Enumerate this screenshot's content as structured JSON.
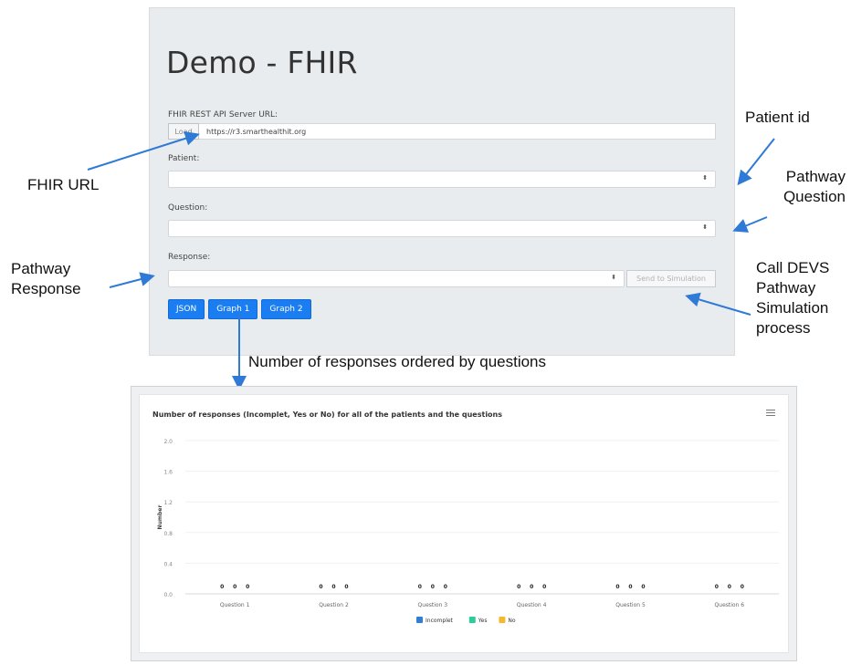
{
  "app": {
    "title": "Demo - FHIR",
    "url_label": "FHIR REST API Server URL:",
    "load_label": "Load",
    "url_value": "https://r3.smarthealthit.org",
    "patient_label": "Patient:",
    "question_label": "Question:",
    "response_label": "Response:",
    "caret": "⬍",
    "send_label": "Send to Simulation",
    "buttons": [
      "JSON",
      "Graph 1",
      "Graph 2"
    ]
  },
  "annotations": {
    "fhir_url": "FHIR URL",
    "patient_id": "Patient id",
    "pathway_question_1": "Pathway",
    "pathway_question_2": "Question",
    "pathway_response_1": "Pathway",
    "pathway_response_2": "Response",
    "devs_1": "Call DEVS",
    "devs_2": "Pathway",
    "devs_3": "Simulation",
    "devs_4": "process",
    "graph_caption": "Number of responses ordered by questions"
  },
  "colors": {
    "incomplet": "#2f7ed8",
    "yes": "#2ecc9a",
    "no": "#f5b82e",
    "button_blue": "#1a7ef2"
  },
  "chart_data": {
    "type": "bar",
    "title": "Number of responses (Incomplet, Yes or No) for all of the patients and the questions",
    "ylabel": "Number",
    "xlabel": "",
    "ylim": [
      0,
      2.0
    ],
    "yticks": [
      "2.0",
      "1.6",
      "1.2",
      "0.8",
      "0.4",
      "0.0"
    ],
    "categories": [
      "Question 1",
      "Question 2",
      "Question 3",
      "Question 4",
      "Question 5",
      "Question 6"
    ],
    "series": [
      {
        "name": "Incomplet",
        "values": [
          0,
          0,
          0,
          0,
          0,
          0
        ]
      },
      {
        "name": "Yes",
        "values": [
          0,
          0,
          0,
          0,
          0,
          0
        ]
      },
      {
        "name": "No",
        "values": [
          0,
          0,
          0,
          0,
          0,
          0
        ]
      }
    ],
    "legend": "bottom-center",
    "grid": true
  }
}
